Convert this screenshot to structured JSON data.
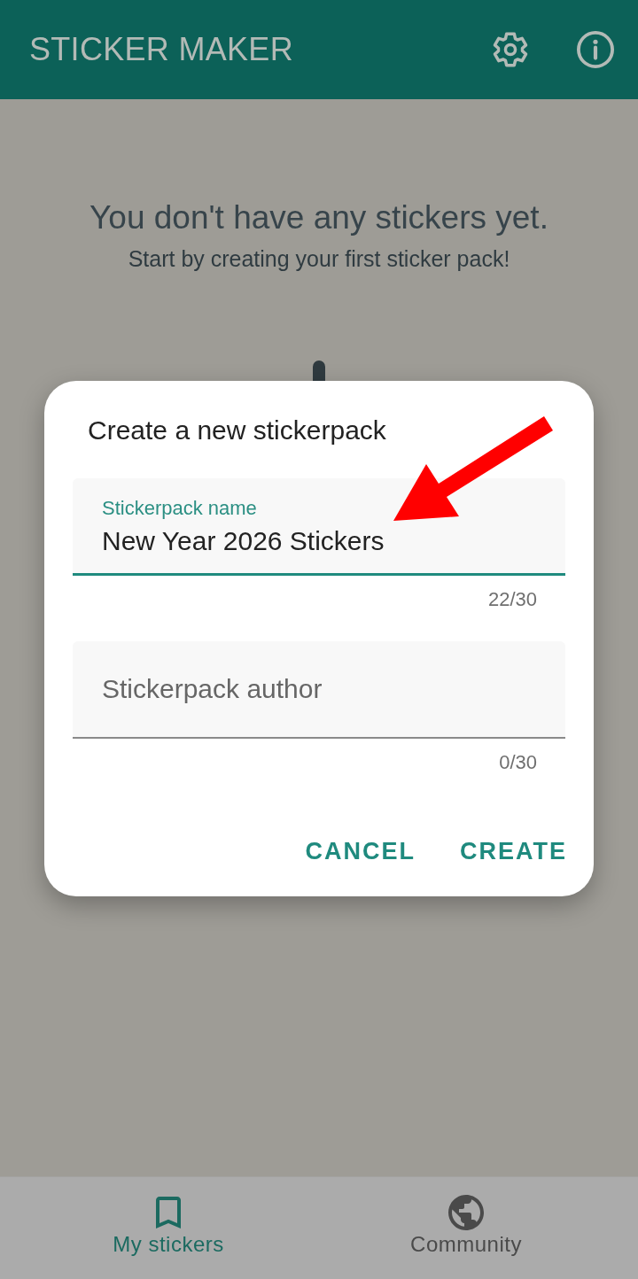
{
  "app_bar": {
    "title": "STICKER MAKER"
  },
  "empty_state": {
    "title": "You don't have any stickers yet.",
    "subtitle": "Start by creating your first sticker pack!"
  },
  "dialog": {
    "title": "Create a new stickerpack",
    "fields": [
      {
        "label": "Stickerpack name",
        "value": "New Year 2026 Stickers",
        "counter": "22/30",
        "focused": true
      },
      {
        "placeholder": "Stickerpack author",
        "counter": "0/30",
        "focused": false
      }
    ],
    "buttons": [
      "CANCEL",
      "CREATE"
    ]
  },
  "bottom_nav": {
    "items": [
      {
        "label": "My stickers",
        "selected": true
      },
      {
        "label": "Community",
        "selected": false
      }
    ]
  }
}
